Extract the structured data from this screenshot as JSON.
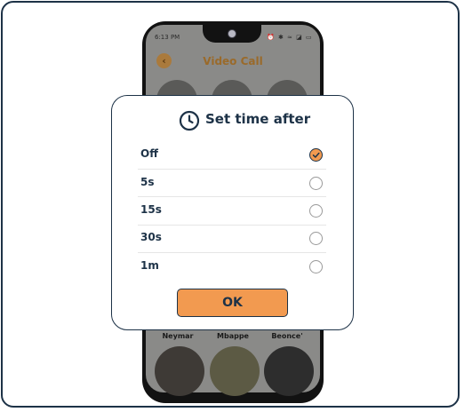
{
  "background_app": {
    "status_time": "6:13 PM",
    "status_icons": "⏰ ✱ ≈ ◪ ▭",
    "title": "Video Call",
    "contacts": [
      "Neymar",
      "Mbappe",
      "Beonce'"
    ]
  },
  "dialog": {
    "title": "Set time after",
    "options": [
      {
        "label": "Off",
        "selected": true
      },
      {
        "label": "5s",
        "selected": false
      },
      {
        "label": "15s",
        "selected": false
      },
      {
        "label": "30s",
        "selected": false
      },
      {
        "label": "1m",
        "selected": false
      }
    ],
    "ok_label": "OK"
  },
  "colors": {
    "accent": "#f29a50",
    "navy": "#1d3247",
    "scrim": "#8a8a88"
  },
  "icons": {
    "title_icon": "clock-icon",
    "selected_icon": "check-icon",
    "back_icon": "chevron-left-icon"
  }
}
